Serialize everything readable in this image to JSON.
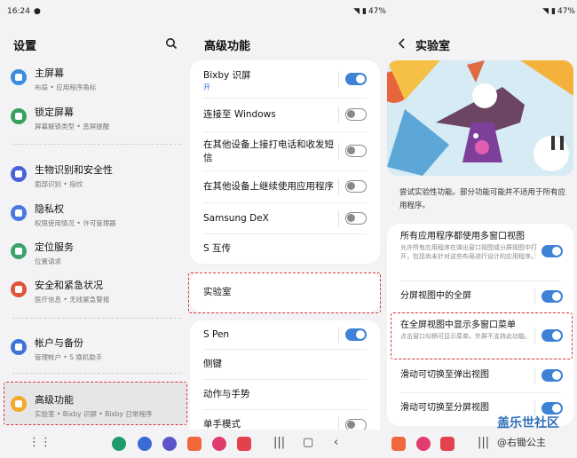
{
  "status": {
    "time": "16:24",
    "battery": "47%"
  },
  "settings": {
    "title": "设置",
    "groups": [
      {
        "items": [
          {
            "title": "主屏幕",
            "sub": "布局 • 应用程序角标",
            "icon": "home-icon",
            "color": "#3b8de0"
          },
          {
            "title": "锁定屏幕",
            "sub": "屏幕解锁类型 • 息屏提醒",
            "icon": "lock-icon",
            "color": "#37a05d"
          }
        ]
      },
      {
        "items": [
          {
            "title": "生物识别和安全性",
            "sub": "面部识别 • 指纹",
            "icon": "shield-icon",
            "color": "#4a62d8"
          },
          {
            "title": "隐私权",
            "sub": "权限使用情况 • 许可管理器",
            "icon": "privacy-icon",
            "color": "#4a78de"
          },
          {
            "title": "定位服务",
            "sub": "位置请求",
            "icon": "location-pin-icon",
            "color": "#3aa36b"
          },
          {
            "title": "安全和紧急状况",
            "sub": "医疗信息 • 无线紧急警报",
            "icon": "emergency-icon",
            "color": "#e0543b"
          }
        ]
      },
      {
        "items": [
          {
            "title": "帐户与备份",
            "sub": "管理帐户 • S 换机助手",
            "icon": "sync-icon",
            "color": "#3f74d6"
          }
        ]
      },
      {
        "items": [
          {
            "title": "高级功能",
            "sub": "实验室 • Bixby 识屏 • Bixby 日常程序",
            "icon": "advanced-features-icon",
            "color": "#f2a82b"
          }
        ]
      }
    ]
  },
  "advanced": {
    "title": "高级功能",
    "card1": [
      {
        "label": "Bixby 识屏",
        "sub": "开",
        "toggle": true
      },
      {
        "label": "连接至 Windows",
        "toggle": false
      },
      {
        "label": "在其他设备上接打电话和收发短信",
        "toggle": false
      },
      {
        "label": "在其他设备上继续使用应用程序",
        "toggle": false
      },
      {
        "label": "Samsung DeX",
        "toggle": false
      },
      {
        "label": "S 互传"
      }
    ],
    "lab_label": "实验室",
    "card3": [
      {
        "label": "S Pen",
        "toggle": true
      },
      {
        "label": "侧键"
      },
      {
        "label": "动作与手势"
      },
      {
        "label": "单手模式",
        "toggle": false
      }
    ]
  },
  "lab": {
    "title": "实验室",
    "intro": "尝试实验性功能。部分功能可能并不适用于所有应用程序。",
    "items": [
      {
        "label": "所有应用程序都使用多窗口视图",
        "sub": "允许所有应用程序在弹出窗口视图或分屏视图中打开，包括尚未针对这些布局进行设计的应用程序。",
        "toggle": true
      },
      {
        "label": "分屏视图中的全屏",
        "toggle": true
      },
      {
        "label": "在全屏视图中显示多窗口菜单",
        "sub": "点击窗口句柄可显示菜单。外屏不支持此功能。",
        "toggle": true
      },
      {
        "label": "滑动可切换至弹出视图",
        "toggle": true
      },
      {
        "label": "滑动可切换至分屏视图",
        "toggle": true
      }
    ]
  },
  "watermark": {
    "line1": "盖乐世社区",
    "line2": "@右锄公主"
  }
}
